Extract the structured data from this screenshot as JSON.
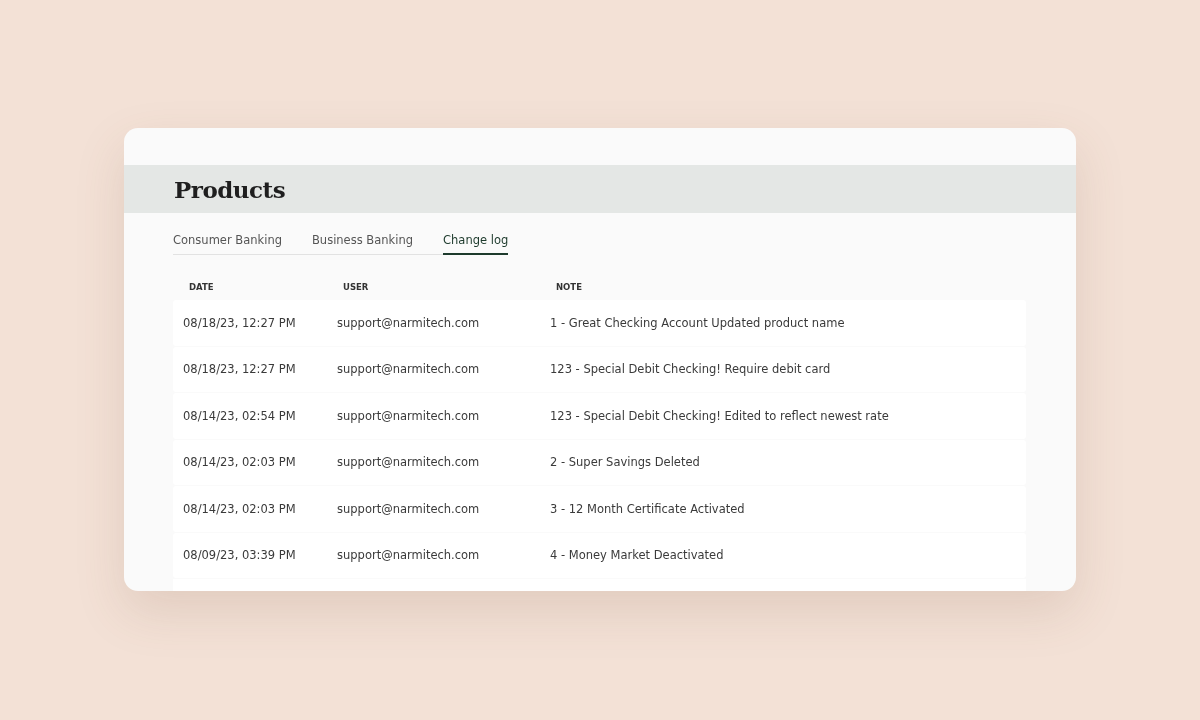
{
  "page": {
    "title": "Products"
  },
  "tabs": [
    {
      "label": "Consumer Banking",
      "selected": false
    },
    {
      "label": "Business Banking",
      "selected": false
    },
    {
      "label": "Change log",
      "selected": true
    }
  ],
  "table": {
    "columns": [
      "DATE",
      "USER",
      "NOTE"
    ],
    "rows": [
      [
        "08/18/23, 12:27 PM",
        "support@narmitech.com",
        "1 - Great Checking Account Updated product name"
      ],
      [
        "08/18/23, 12:27 PM",
        "support@narmitech.com",
        "123 - Special Debit Checking! Require debit card"
      ],
      [
        "08/14/23, 02:54 PM",
        "support@narmitech.com",
        "123 - Special Debit Checking! Edited to reflect newest rate"
      ],
      [
        "08/14/23, 02:03 PM",
        "support@narmitech.com",
        "2 - Super Savings Deleted"
      ],
      [
        "08/14/23, 02:03 PM",
        "support@narmitech.com",
        "3 - 12 Month Certificate Activated"
      ],
      [
        "08/09/23, 03:39 PM",
        "support@narmitech.com",
        "4 - Money Market Deactivated"
      ]
    ]
  }
}
